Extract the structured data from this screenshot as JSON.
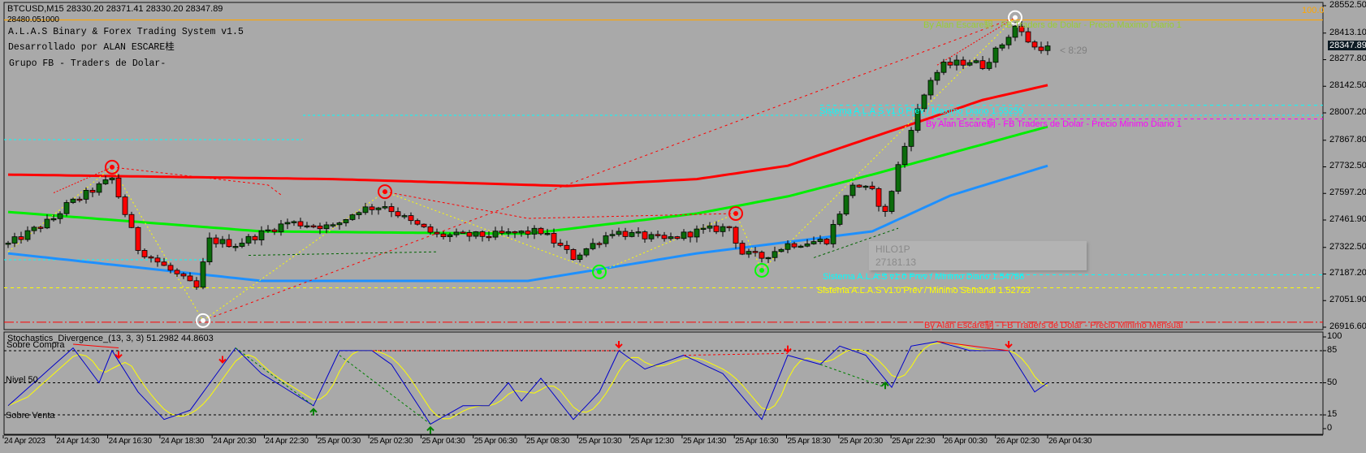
{
  "header": {
    "symbol_line": "BTCUSD,M15  28330.20 28371.41 28330.20 28347.89",
    "level_line": "28480.051000",
    "title": "A.L.A.S Binary & Forex Trading System v1.5",
    "author": "Desarrollado por ALAN ESCARE桂",
    "group": "Grupo FB - Traders de Dolar-"
  },
  "chart_labels": {
    "max_diario": "By Alan Escare駉 - FB Traders de Dolar - Precio Maximo Diario 1",
    "prev_max_diario": "Sistema A.L.A.S v1.0 Prev / Maximo Diario 1.55259",
    "min_diario": "By Alan Escare駉 - FB Traders de Dolar - Precio Minimo Diario 1",
    "prev_min_diario": "Sistema A.L.A.S v1.0 Prev / Minimo Diario 1.54786",
    "prev_min_semanal": "Sistema A.L.A.S v1.0 Prev / Minimo Semanal 1.52723",
    "min_mensual": "By Alan Escare駉 - FB Traders de Dolar - Precio Minimo Mensual",
    "countdown": "< 8:29",
    "fib_level": "100.0"
  },
  "hilo": {
    "name": "HILO1P",
    "value": "27181.13"
  },
  "price_axis": {
    "labels": [
      "28552.50",
      "28413.10",
      "28277.80",
      "28142.50",
      "28007.20",
      "27867.80",
      "27732.50",
      "27597.20",
      "27461.90",
      "27322.50",
      "27187.20",
      "27051.90",
      "26916.60"
    ],
    "current": "28347.89"
  },
  "stoch": {
    "title": "Stochastics_Divergence_(13, 3, 3) 51.2982 44.8603",
    "overbought_label": "Sobre Compra",
    "mid_label": "Nivel 50",
    "oversold_label": "Sobre Venta",
    "axis_labels": [
      "100",
      "85",
      "50",
      "15",
      "0"
    ]
  },
  "time_axis": {
    "labels": [
      "24 Apr 2023",
      "24 Apr 14:30",
      "24 Apr 16:30",
      "24 Apr 18:30",
      "24 Apr 20:30",
      "24 Apr 22:30",
      "25 Apr 00:30",
      "25 Apr 02:30",
      "25 Apr 04:30",
      "25 Apr 06:30",
      "25 Apr 08:30",
      "25 Apr 10:30",
      "25 Apr 12:30",
      "25 Apr 14:30",
      "25 Apr 16:30",
      "25 Apr 18:30",
      "25 Apr 20:30",
      "25 Apr 22:30",
      "26 Apr 00:30",
      "26 Apr 02:30",
      "26 Apr 04:30"
    ]
  },
  "colors": {
    "background": "#a9a9a9",
    "bull": "#0b6b0b",
    "bear": "#ff0000",
    "ma_red": "#ff0000",
    "ma_green": "#00ee00",
    "ma_blue": "#1e90ff",
    "stoch_main": "#0000cc",
    "stoch_signal": "#ffff00",
    "orange_level": "#ffa500",
    "cyan_level": "#00ffff",
    "magenta_level": "#ff00ff",
    "yellow_level": "#ffff00",
    "label_green": "#9acd32"
  },
  "chart_data": {
    "type": "candlestick",
    "symbol": "BTCUSD",
    "timeframe": "M15",
    "ylim": [
      26916.6,
      28552.5
    ],
    "close_keypoints": [
      [
        0,
        27338
      ],
      [
        7,
        27470
      ],
      [
        9,
        27536
      ],
      [
        16,
        27672
      ],
      [
        20,
        27317
      ],
      [
        23,
        27249
      ],
      [
        29,
        27114
      ],
      [
        31,
        27359
      ],
      [
        35,
        27338
      ],
      [
        43,
        27450
      ],
      [
        50,
        27426
      ],
      [
        54,
        27515
      ],
      [
        58,
        27536
      ],
      [
        62,
        27450
      ],
      [
        66,
        27383
      ],
      [
        74,
        27383
      ],
      [
        82,
        27404
      ],
      [
        87,
        27272
      ],
      [
        93,
        27404
      ],
      [
        101,
        27360
      ],
      [
        106,
        27404
      ],
      [
        111,
        27426
      ],
      [
        113,
        27292
      ],
      [
        116,
        27272
      ],
      [
        120,
        27338
      ],
      [
        126,
        27360
      ],
      [
        130,
        27647
      ],
      [
        133,
        27604
      ],
      [
        135,
        27494
      ],
      [
        137,
        27738
      ],
      [
        139,
        27937
      ],
      [
        142,
        28180
      ],
      [
        144,
        28247
      ],
      [
        148,
        28271
      ],
      [
        150,
        28247
      ],
      [
        153,
        28358
      ],
      [
        155,
        28449
      ],
      [
        158,
        28338
      ],
      [
        160,
        28347.89
      ]
    ],
    "ma_red": [
      [
        0,
        27693
      ],
      [
        50,
        27670
      ],
      [
        86,
        27635
      ],
      [
        106,
        27670
      ],
      [
        120,
        27738
      ],
      [
        130,
        27850
      ],
      [
        140,
        27960
      ],
      [
        150,
        28073
      ],
      [
        160,
        28148
      ]
    ],
    "ma_green": [
      [
        0,
        27503
      ],
      [
        39,
        27404
      ],
      [
        80,
        27392
      ],
      [
        106,
        27495
      ],
      [
        120,
        27582
      ],
      [
        133,
        27693
      ],
      [
        160,
        27937
      ]
    ],
    "ma_blue": [
      [
        0,
        27292
      ],
      [
        39,
        27152
      ],
      [
        80,
        27152
      ],
      [
        106,
        27292
      ],
      [
        133,
        27404
      ],
      [
        145,
        27586
      ],
      [
        160,
        27738
      ]
    ],
    "levels": {
      "max_diario": 28480.05,
      "prev_max_diario": 28046,
      "min_diario": 27976,
      "prev_min_diario": 27183,
      "prev_min_semanal": 27117,
      "min_mensual": 26942
    },
    "signals": [
      {
        "type": "sell",
        "index": 16,
        "price": 27731
      },
      {
        "type": "sell",
        "index": 58,
        "price": 27606
      },
      {
        "type": "sell",
        "index": 112,
        "price": 27495
      },
      {
        "type": "extreme",
        "index": 30,
        "price": 26950
      },
      {
        "type": "extreme",
        "index": 155,
        "price": 28492
      },
      {
        "type": "buy",
        "index": 91,
        "price": 27198
      },
      {
        "type": "buy",
        "index": 116,
        "price": 27206
      }
    ],
    "zigzag": [
      [
        0,
        27300
      ],
      [
        16,
        27731
      ],
      [
        30,
        26950
      ],
      [
        58,
        27606
      ],
      [
        91,
        27198
      ],
      [
        112,
        27495
      ],
      [
        116,
        27206
      ],
      [
        155,
        28492
      ]
    ],
    "stochastic": {
      "main": [
        [
          0,
          25
        ],
        [
          10,
          88
        ],
        [
          14,
          50
        ],
        [
          16,
          85
        ],
        [
          20,
          40
        ],
        [
          24,
          10
        ],
        [
          28,
          20
        ],
        [
          35,
          88
        ],
        [
          39,
          60
        ],
        [
          47,
          25
        ],
        [
          51,
          85
        ],
        [
          56,
          85
        ],
        [
          59,
          70
        ],
        [
          65,
          5
        ],
        [
          70,
          25
        ],
        [
          74,
          25
        ],
        [
          77,
          50
        ],
        [
          79,
          30
        ],
        [
          82,
          55
        ],
        [
          87,
          10
        ],
        [
          91,
          40
        ],
        [
          94,
          85
        ],
        [
          98,
          65
        ],
        [
          104,
          80
        ],
        [
          110,
          60
        ],
        [
          116,
          10
        ],
        [
          120,
          80
        ],
        [
          125,
          70
        ],
        [
          128,
          90
        ],
        [
          132,
          80
        ],
        [
          136,
          45
        ],
        [
          139,
          90
        ],
        [
          143,
          95
        ],
        [
          148,
          85
        ],
        [
          154,
          85
        ],
        [
          158,
          40
        ],
        [
          160,
          50
        ]
      ],
      "levels": [
        85,
        50,
        15
      ],
      "sell_arrows": [
        17,
        33,
        94,
        120,
        154
      ],
      "buy_arrows": [
        47,
        65,
        135
      ]
    }
  }
}
